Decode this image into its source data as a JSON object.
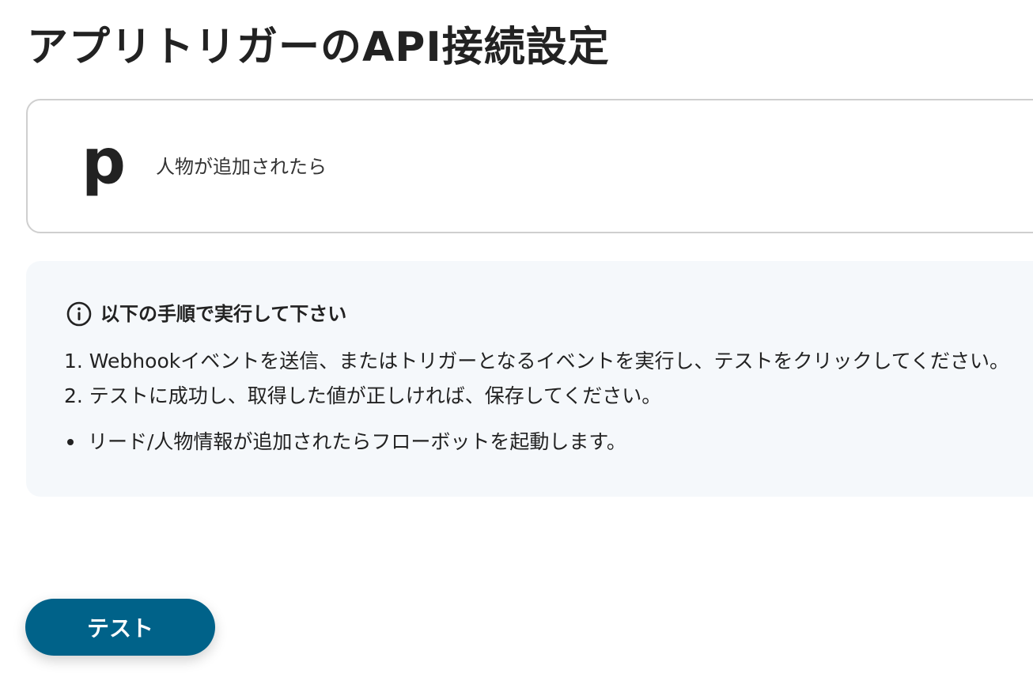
{
  "page": {
    "title": "アプリトリガーのAPI接続設定"
  },
  "trigger_card": {
    "app_logo_letter": "p",
    "app_logo_icon": "pipedrive-logo-icon",
    "trigger_name": "人物が追加されたら"
  },
  "instructions": {
    "icon": "info-icon",
    "title": "以下の手順で実行して下さい",
    "steps": [
      "1. Webhookイベントを送信、またはトリガーとなるイベントを実行し、テストをクリックしてください。",
      "2. テストに成功し、取得した値が正しければ、保存してください。"
    ],
    "note": "リード/人物情報が追加されたらフローボットを起動します。"
  },
  "actions": {
    "test_label": "テスト"
  },
  "colors": {
    "primary_button": "#006289",
    "instructions_background": "#f5f8fb",
    "card_border": "#cfcfcf",
    "text": "#222222"
  }
}
